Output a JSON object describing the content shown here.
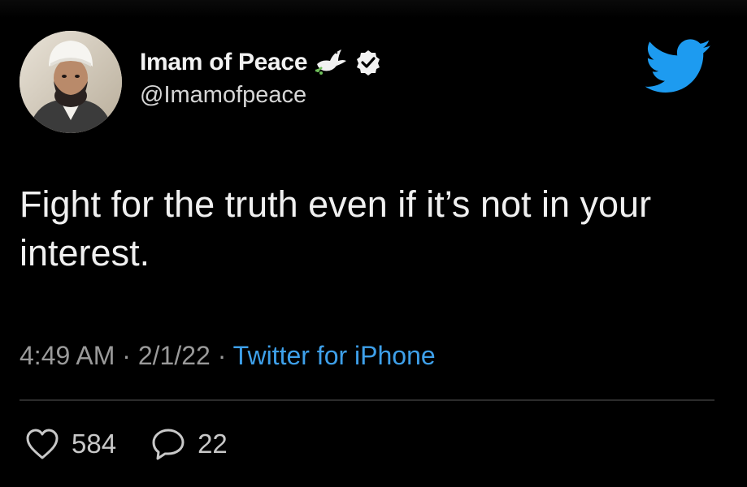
{
  "tweet": {
    "display_name": "Imam of Peace",
    "handle": "@Imamofpeace",
    "text": "Fight for the truth even if it’s not in your interest.",
    "time": "4:49 AM",
    "separator": "·",
    "date": "2/1/22",
    "source": "Twitter for iPhone",
    "likes": "584",
    "replies": "22"
  },
  "icons": {
    "brand": "twitter-bird-icon",
    "verified": "verified-badge-icon",
    "emoji": "dove-icon",
    "like": "heart-icon",
    "reply": "reply-bubble-icon"
  },
  "colors": {
    "background": "#000000",
    "brand_blue": "#1d9bf0",
    "source_link": "#3ea0ea",
    "meta_text": "#9a9a9a"
  }
}
